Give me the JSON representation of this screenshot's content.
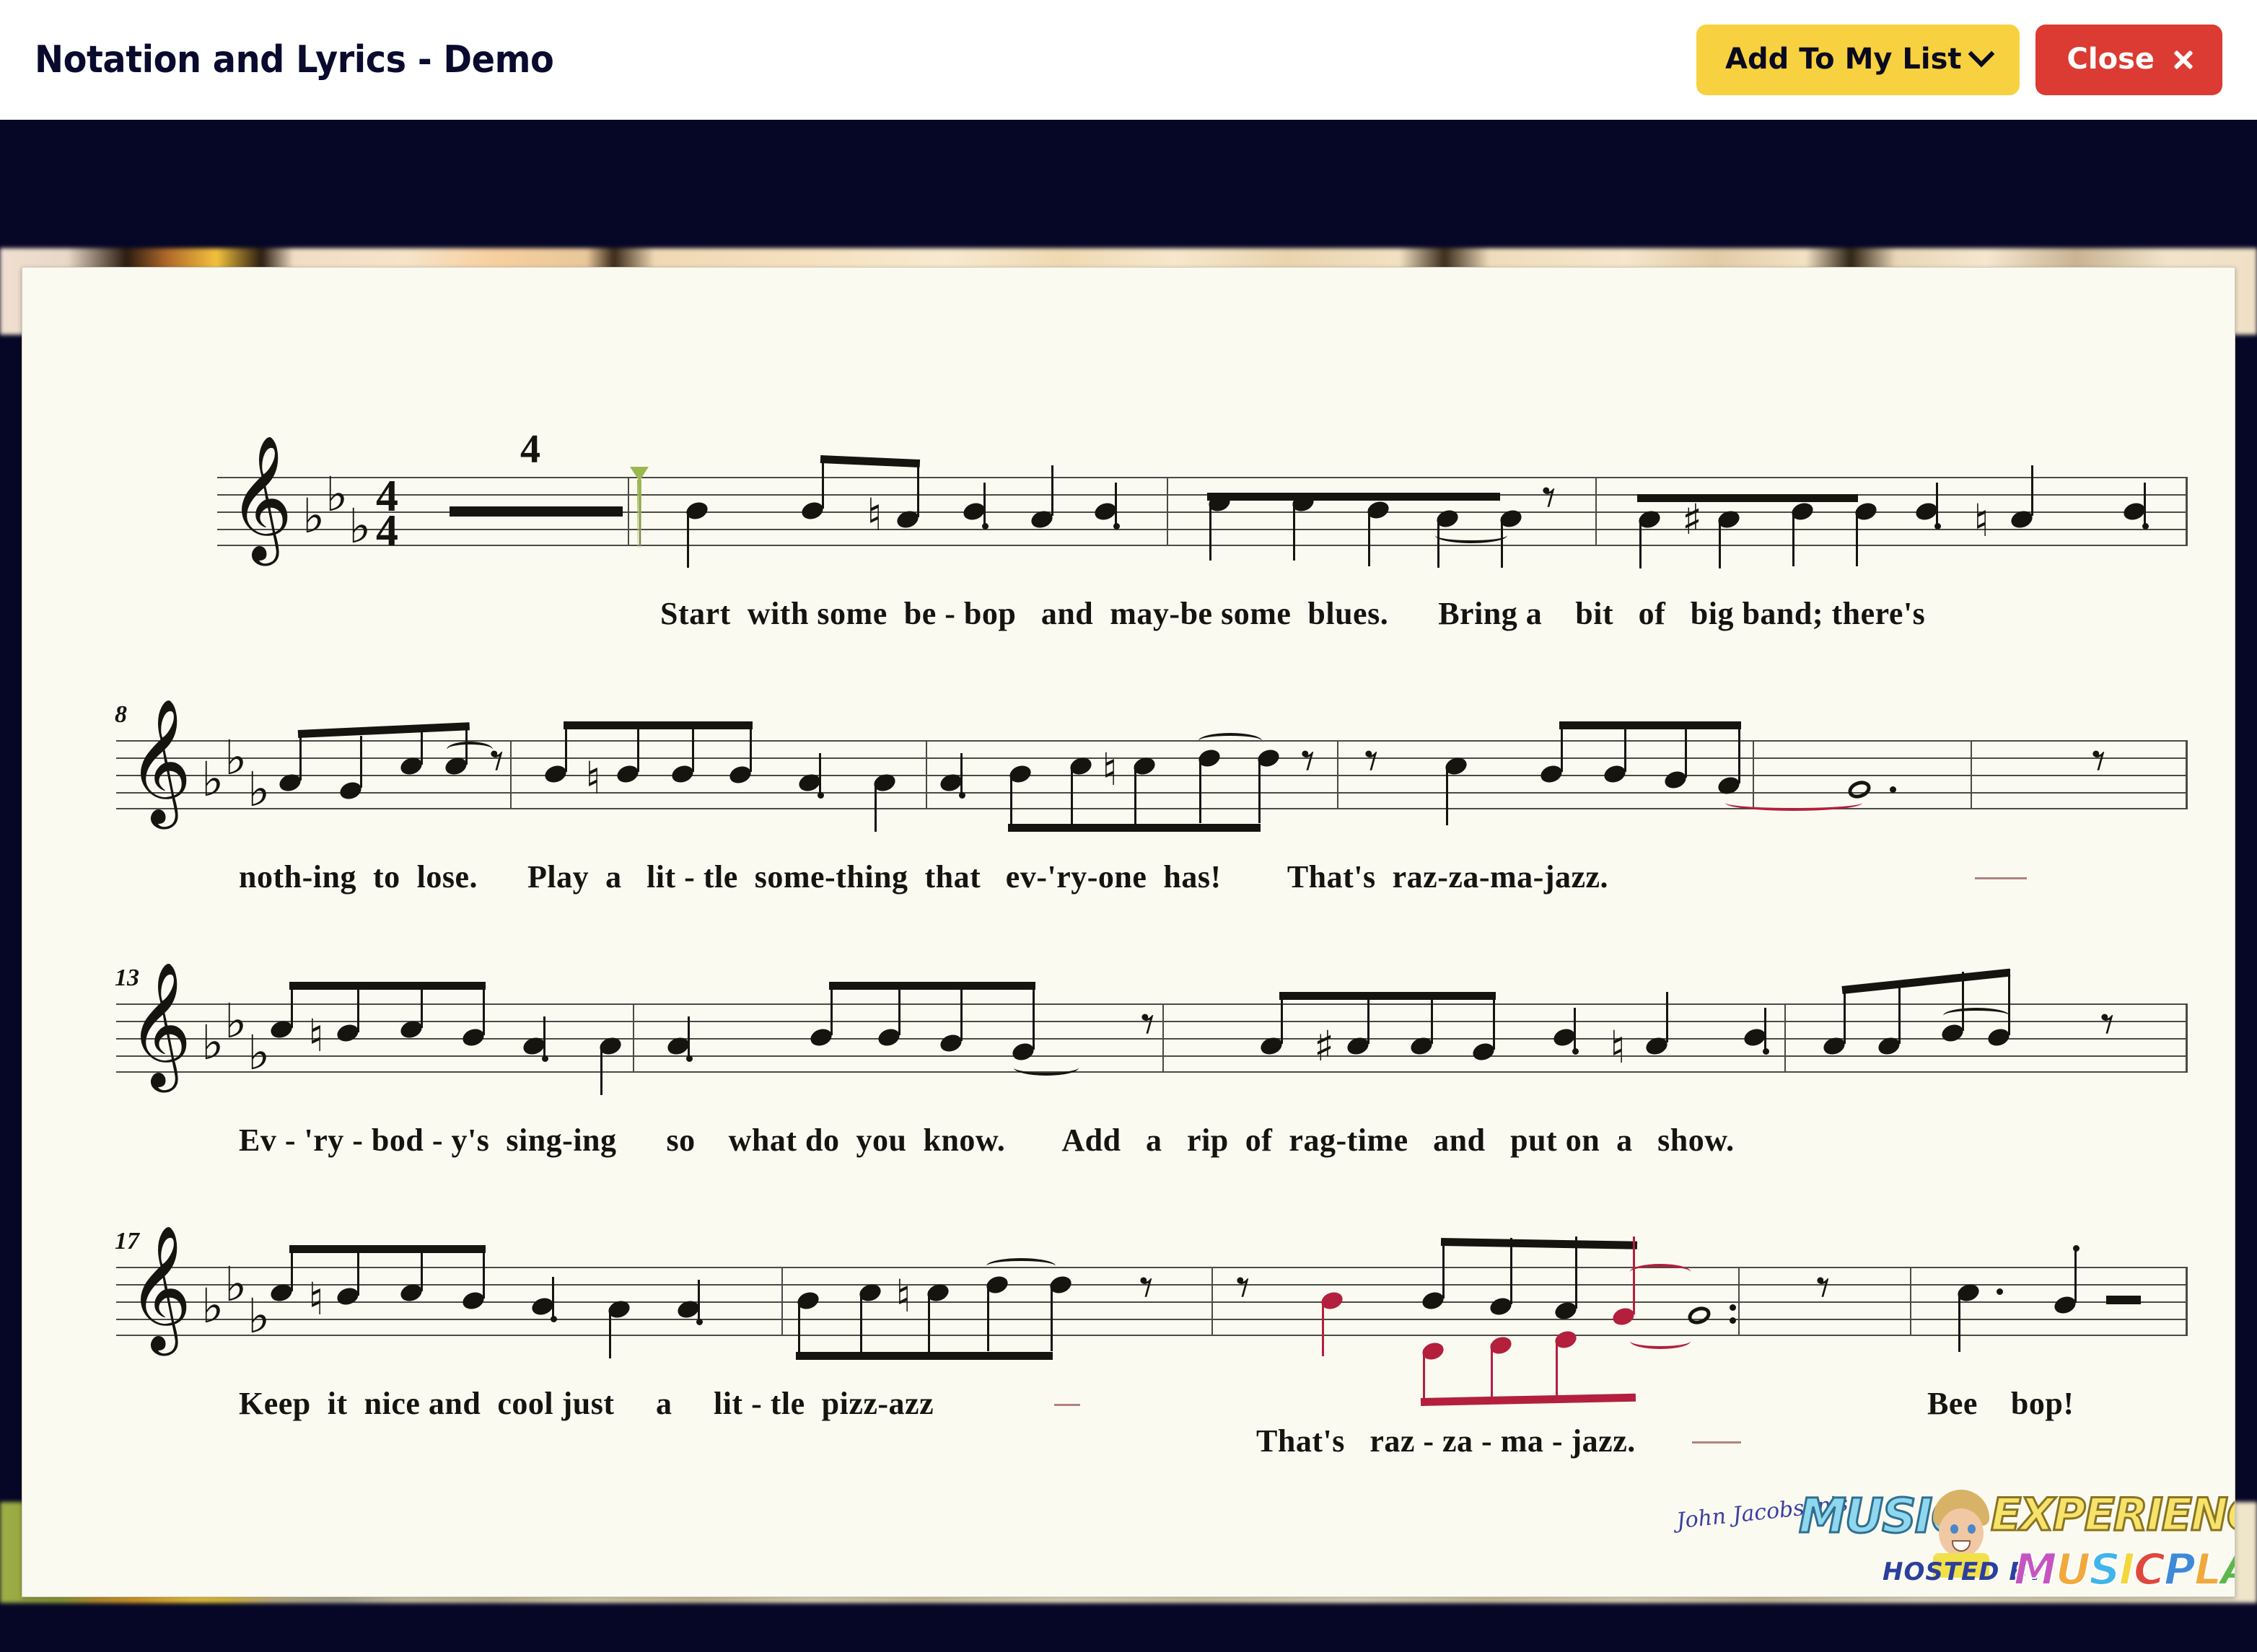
{
  "header": {
    "title": "Notation and Lyrics - Demo",
    "add_to_list_label": "Add To My List",
    "add_to_list_icon": "chevron-down-icon",
    "close_label": "Close",
    "close_icon": "close-x-icon"
  },
  "colors": {
    "accent_yellow": "#f7d13f",
    "close_red": "#db3b32",
    "title_navy": "#0a0a2e",
    "viewer_backdrop": "#060726",
    "paper": "#fbfaf1",
    "staff_line": "#4a4a46",
    "ink": "#16140f",
    "voice2_red": "#b31f3c",
    "cursor_green": "#9bb84f"
  },
  "score": {
    "clef": "treble-clef",
    "key_signature": "3 flats (E-flat major)",
    "time_signature": "4/4",
    "time_sig_top": "4",
    "time_sig_bottom": "4",
    "multi_measure_rest_count": "4",
    "systems": [
      {
        "measure_number": "",
        "lyrics": [
          "Start  with some  be - bop   and  may-be some  blues.      Bring a    bit   of   big band; there's"
        ]
      },
      {
        "measure_number": "8",
        "lyrics": [
          "noth-ing  to  lose.      Play  a   lit - tle  some-thing  that   ev-'ry-one  has!        That's  raz-za-ma-jazz."
        ]
      },
      {
        "measure_number": "13",
        "lyrics": [
          "Ev - 'ry - bod - y's  sing-ing      so    what do  you  know.       Add   a   rip  of  rag-time   and   put on  a   show."
        ]
      },
      {
        "measure_number": "17",
        "lyrics": [
          "Keep  it  nice and  cool just     a     lit - tle  pizz-azz",
          "That's   raz - za - ma - jazz.",
          "Bee    bop!"
        ]
      }
    ]
  },
  "logo": {
    "signature": "John Jacobson's",
    "word_music": "MUSIC",
    "word_experience": "EXPERIENCE",
    "hosted_by": "HOSTED BY",
    "musicplay": "MUSICPLAY"
  }
}
